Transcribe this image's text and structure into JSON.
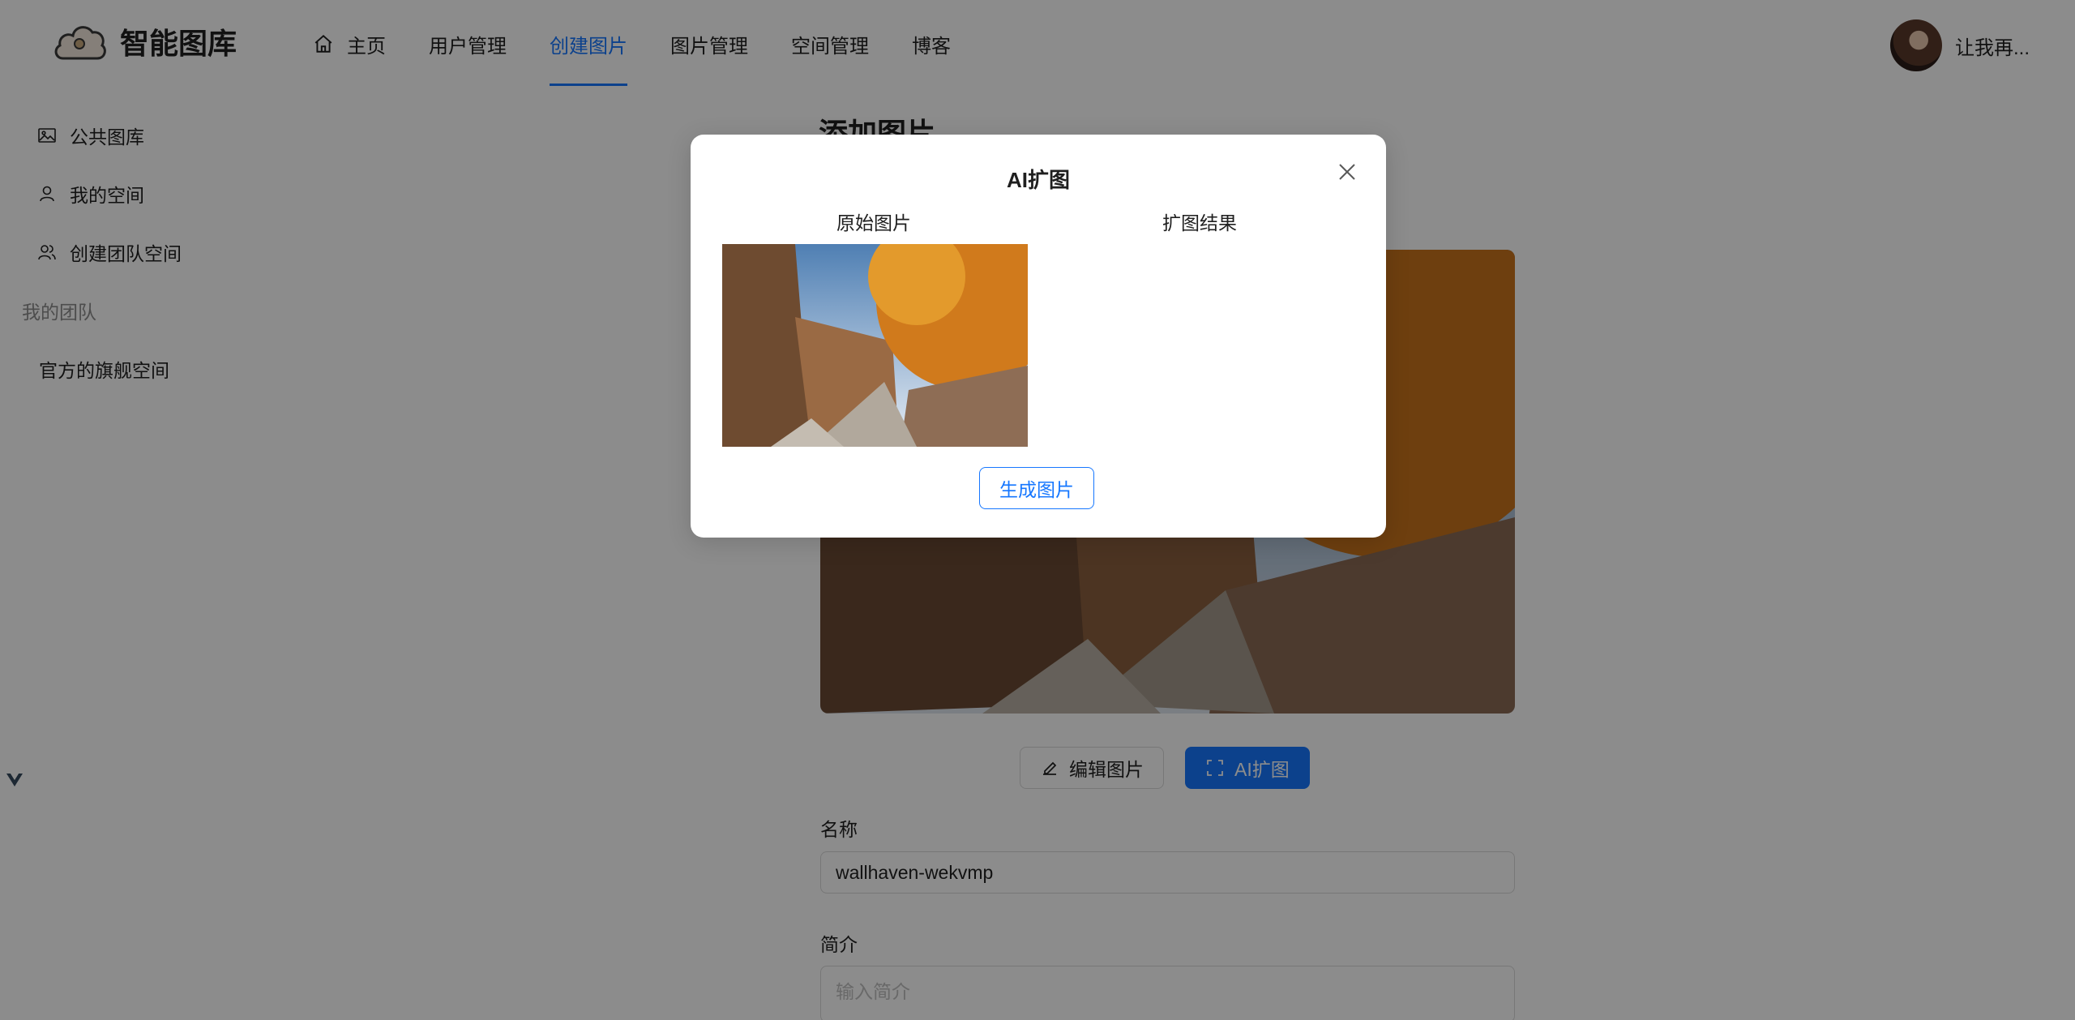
{
  "header": {
    "logo_text": "智能图库",
    "nav": [
      {
        "label": "主页",
        "icon": "home-icon"
      },
      {
        "label": "用户管理"
      },
      {
        "label": "创建图片",
        "active": true
      },
      {
        "label": "图片管理"
      },
      {
        "label": "空间管理"
      },
      {
        "label": "博客"
      }
    ],
    "user_name": "让我再..."
  },
  "sidebar": {
    "items": [
      {
        "label": "公共图库",
        "icon": "picture-icon"
      },
      {
        "label": "我的空间",
        "icon": "user-icon"
      },
      {
        "label": "创建团队空间",
        "icon": "team-icon"
      }
    ],
    "group_title": "我的团队",
    "team_items": [
      {
        "label": "官方的旗舰空间"
      }
    ]
  },
  "main": {
    "title": "添加图片",
    "edit_button": "编辑图片",
    "ai_button": "AI扩图",
    "name_label": "名称",
    "name_value": "wallhaven-wekvmp",
    "intro_label": "简介",
    "intro_placeholder": "输入简介"
  },
  "modal": {
    "title": "AI扩图",
    "original_label": "原始图片",
    "result_label": "扩图结果",
    "generate_button": "生成图片"
  },
  "colors": {
    "accent": "#1677ff",
    "mask": "rgba(0,0,0,0.45)"
  }
}
